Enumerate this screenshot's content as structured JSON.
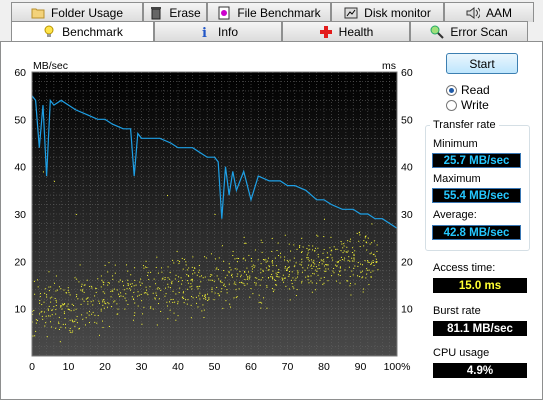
{
  "tabs_row1": [
    {
      "label": "Folder Usage",
      "icon": "folder-icon"
    },
    {
      "label": "Erase",
      "icon": "trash-icon"
    },
    {
      "label": "File Benchmark",
      "icon": "file-benchmark-icon"
    },
    {
      "label": "Disk monitor",
      "icon": "disk-monitor-icon"
    },
    {
      "label": "AAM",
      "icon": "speaker-icon"
    }
  ],
  "tabs_row2": [
    {
      "label": "Benchmark",
      "icon": "lightbulb-icon",
      "active": true
    },
    {
      "label": "Info",
      "icon": "info-icon"
    },
    {
      "label": "Health",
      "icon": "health-cross-icon"
    },
    {
      "label": "Error Scan",
      "icon": "magnifier-icon"
    }
  ],
  "controls": {
    "start_label": "Start",
    "read_label": "Read",
    "write_label": "Write",
    "selected_mode": "Read"
  },
  "stats": {
    "transfer_rate_title": "Transfer rate",
    "minimum_label": "Minimum",
    "minimum_value": "25.7 MB/sec",
    "maximum_label": "Maximum",
    "maximum_value": "55.4 MB/sec",
    "average_label": "Average:",
    "average_value": "42.8 MB/sec",
    "access_time_label": "Access time:",
    "access_time_value": "15.0 ms",
    "burst_rate_label": "Burst rate",
    "burst_rate_value": "81.1 MB/sec",
    "cpu_usage_label": "CPU usage",
    "cpu_usage_value": "4.9%"
  },
  "chart_data": {
    "type": "line",
    "y_left_unit": "MB/sec",
    "y_right_unit": "ms",
    "ylim": [
      0,
      60
    ],
    "xlim": [
      0,
      100
    ],
    "y_ticks": [
      10,
      20,
      30,
      40,
      50,
      60
    ],
    "x_ticks": [
      "0",
      "10",
      "20",
      "30",
      "40",
      "50",
      "60",
      "70",
      "80",
      "90",
      "100%"
    ],
    "series": [
      {
        "kind": "transfer-rate",
        "color": "#1ea0e6",
        "x": [
          0,
          1,
          2,
          3,
          4,
          5,
          6,
          8,
          10,
          12,
          15,
          18,
          20,
          22,
          25,
          27,
          28,
          29,
          30,
          32,
          35,
          38,
          40,
          42,
          44,
          46,
          48,
          50,
          51,
          52,
          53,
          54,
          55,
          56,
          58,
          60,
          62,
          65,
          68,
          70,
          72,
          75,
          78,
          80,
          82,
          85,
          88,
          90,
          92,
          94,
          96,
          98,
          100
        ],
        "y": [
          55,
          54,
          44,
          53,
          38,
          54,
          53,
          54,
          53,
          52,
          51,
          50,
          50,
          49,
          48,
          48,
          38,
          47,
          46,
          46,
          46,
          45,
          44,
          44,
          44,
          43,
          42,
          42,
          41,
          29,
          40,
          34,
          39,
          35,
          39,
          33,
          38,
          37,
          37,
          36,
          36,
          35,
          33,
          33,
          32,
          31,
          31,
          30,
          30,
          29,
          29,
          28,
          27
        ]
      },
      {
        "kind": "access-time-scatter",
        "color": "#ffff33",
        "trend": {
          "x": [
            0,
            100
          ],
          "y": [
            10,
            22
          ]
        }
      }
    ]
  }
}
